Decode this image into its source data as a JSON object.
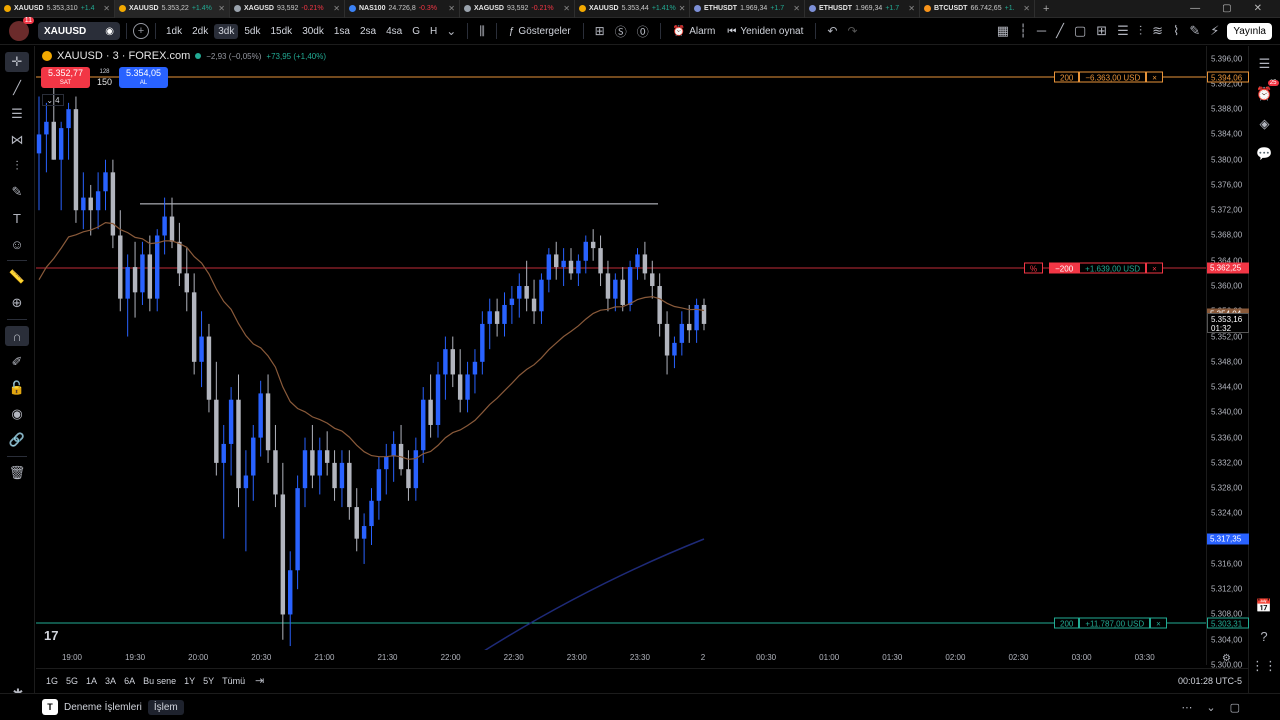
{
  "browser_tabs": [
    {
      "symbol": "XAUUSD",
      "price": "5.353,310",
      "change": "+1.4",
      "dir": "up",
      "active": false,
      "dot": ""
    },
    {
      "symbol": "XAUUSD",
      "price": "5.353,22",
      "change": "+1.4%",
      "dir": "up",
      "active": true,
      "dot": ""
    },
    {
      "symbol": "XAGUSD",
      "price": "93,592",
      "change": "-0.21%",
      "dir": "dn",
      "active": false,
      "dot": "xag"
    },
    {
      "symbol": "NAS100",
      "price": "24.726,8",
      "change": "-0.3%",
      "dir": "dn",
      "active": false,
      "dot": "nas"
    },
    {
      "symbol": "XAGUSD",
      "price": "93,592",
      "change": "-0.21%",
      "dir": "dn",
      "active": false,
      "dot": "xag"
    },
    {
      "symbol": "XAUUSD",
      "price": "5.353,44",
      "change": "+1.41%",
      "dir": "up",
      "active": false,
      "dot": ""
    },
    {
      "symbol": "ETHUSDT",
      "price": "1.969,34",
      "change": "+1.7",
      "dir": "up",
      "active": false,
      "dot": "eth"
    },
    {
      "symbol": "ETHUSDT",
      "price": "1.969,34",
      "change": "+1.7",
      "dir": "up",
      "active": false,
      "dot": "eth"
    },
    {
      "symbol": "BTCUSDT",
      "price": "66.742,65",
      "change": "+1.",
      "dir": "up",
      "active": false,
      "dot": "btc"
    }
  ],
  "toolbar": {
    "avatar_badge": "11",
    "symbol": "XAUUSD",
    "timeframes": [
      "1dk",
      "2dk",
      "3dk",
      "5dk",
      "15dk",
      "30dk",
      "1sa",
      "2sa",
      "4sa",
      "G",
      "H"
    ],
    "active_timeframe": "3dk",
    "indicators_label": "Göstergeler",
    "alarm_label": "Alarm",
    "replay_label": "Yeniden oynat",
    "publish_label": "Yayınla"
  },
  "legend": {
    "title": "XAUUSD · 3 · FOREX.com",
    "change": "−2,93 (−0,05%)",
    "change2": "+73,95 (+1,40%)",
    "sell_price": "5.352,77",
    "sell_label": "SAT",
    "buy_price": "5.354,05",
    "buy_label": "AL",
    "spread_top": "128",
    "spread_qty": "150",
    "collapse_count": "4"
  },
  "price_axis": {
    "ticks": [
      "5.396,00",
      "5.392,00",
      "5.388,00",
      "5.384,00",
      "5.380,00",
      "5.376,00",
      "5.372,00",
      "5.368,00",
      "5.364,00",
      "5.360,00",
      "5.356,00",
      "5.352,00",
      "5.348,00",
      "5.344,00",
      "5.340,00",
      "5.336,00",
      "5.332,00",
      "5.328,00",
      "5.324,00",
      "5.320,00",
      "5.316,00",
      "5.312,00",
      "5.308,00",
      "5.304,00",
      "5.300,00"
    ],
    "tag_tp": "5.394,06",
    "tag_pos": "5.362,25",
    "tag_last": "5.353,16",
    "tag_countdown": "01:32",
    "tag_blue": "5.317,35",
    "tag_sl": "5.303,31",
    "tag_ema": "5.354,04"
  },
  "orders": {
    "tp": {
      "qty": "200",
      "pnl": "−6.363,00 USD",
      "close": "×"
    },
    "pos": {
      "pct": "%",
      "qty": "−200",
      "pnl": "+1.639,00 USD",
      "close": "×"
    },
    "sl": {
      "qty": "200",
      "pnl": "+11.787,00 USD",
      "close": "×"
    }
  },
  "time_axis": [
    "19:00",
    "19:30",
    "20:00",
    "20:30",
    "21:00",
    "21:30",
    "22:00",
    "22:30",
    "23:00",
    "23:30",
    "2",
    "00:30",
    "01:00",
    "01:30",
    "02:00",
    "02:30",
    "03:00",
    "03:30"
  ],
  "range_bar": {
    "ranges": [
      "1G",
      "5G",
      "1A",
      "3A",
      "6A",
      "Bu sene",
      "1Y",
      "5Y",
      "Tümü"
    ],
    "clock": "00:01:28 UTC-5"
  },
  "bottom_panel": {
    "logo": "T",
    "items": [
      "Deneme İşlemleri",
      "İşlem"
    ]
  },
  "colors": {
    "up": "#2962ff",
    "down": "#b2b5be",
    "ema": "#8a5a3a",
    "tp_line": "#e8943a",
    "pos_line": "#f23645",
    "sl_line": "#22ab94",
    "blue_line": "#1e2a78"
  },
  "chart_data": {
    "type": "candlestick",
    "symbol": "XAUUSD",
    "interval": "3",
    "ylim": [
      5300,
      5398
    ],
    "x_labels": [
      "19:00",
      "19:30",
      "20:00",
      "20:30",
      "21:00",
      "21:30",
      "22:00",
      "22:30",
      "23:00",
      "23:30",
      "2"
    ],
    "candles": [
      [
        5381,
        5390,
        5372,
        5384
      ],
      [
        5384,
        5389,
        5378,
        5386
      ],
      [
        5386,
        5392,
        5380,
        5380
      ],
      [
        5380,
        5386,
        5372,
        5385
      ],
      [
        5385,
        5389,
        5380,
        5388
      ],
      [
        5388,
        5390,
        5370,
        5372
      ],
      [
        5372,
        5378,
        5369,
        5374
      ],
      [
        5374,
        5376,
        5368,
        5372
      ],
      [
        5372,
        5378,
        5369,
        5375
      ],
      [
        5375,
        5380,
        5372,
        5378
      ],
      [
        5378,
        5380,
        5366,
        5368
      ],
      [
        5368,
        5372,
        5356,
        5358
      ],
      [
        5358,
        5365,
        5352,
        5363
      ],
      [
        5363,
        5367,
        5355,
        5359
      ],
      [
        5359,
        5367,
        5357,
        5365
      ],
      [
        5365,
        5368,
        5356,
        5358
      ],
      [
        5358,
        5369,
        5356,
        5368
      ],
      [
        5368,
        5374,
        5365,
        5371
      ],
      [
        5371,
        5374,
        5366,
        5367
      ],
      [
        5367,
        5370,
        5360,
        5362
      ],
      [
        5362,
        5366,
        5356,
        5359
      ],
      [
        5359,
        5362,
        5346,
        5348
      ],
      [
        5348,
        5356,
        5344,
        5352
      ],
      [
        5352,
        5354,
        5340,
        5342
      ],
      [
        5342,
        5348,
        5330,
        5332
      ],
      [
        5332,
        5338,
        5320,
        5335
      ],
      [
        5335,
        5344,
        5330,
        5342
      ],
      [
        5342,
        5346,
        5325,
        5328
      ],
      [
        5328,
        5334,
        5318,
        5330
      ],
      [
        5330,
        5338,
        5326,
        5336
      ],
      [
        5336,
        5345,
        5333,
        5343
      ],
      [
        5343,
        5346,
        5332,
        5334
      ],
      [
        5334,
        5338,
        5325,
        5327
      ],
      [
        5327,
        5332,
        5304,
        5308
      ],
      [
        5308,
        5318,
        5303,
        5315
      ],
      [
        5315,
        5330,
        5312,
        5328
      ],
      [
        5328,
        5336,
        5325,
        5334
      ],
      [
        5334,
        5338,
        5328,
        5330
      ],
      [
        5330,
        5336,
        5327,
        5334
      ],
      [
        5334,
        5337,
        5330,
        5332
      ],
      [
        5332,
        5334,
        5326,
        5328
      ],
      [
        5328,
        5334,
        5325,
        5332
      ],
      [
        5332,
        5334,
        5323,
        5325
      ],
      [
        5325,
        5328,
        5318,
        5320
      ],
      [
        5320,
        5324,
        5316,
        5322
      ],
      [
        5322,
        5328,
        5319,
        5326
      ],
      [
        5326,
        5333,
        5323,
        5331
      ],
      [
        5331,
        5335,
        5327,
        5333
      ],
      [
        5333,
        5337,
        5329,
        5335
      ],
      [
        5335,
        5338,
        5330,
        5331
      ],
      [
        5331,
        5334,
        5326,
        5328
      ],
      [
        5328,
        5336,
        5326,
        5334
      ],
      [
        5334,
        5344,
        5332,
        5342
      ],
      [
        5342,
        5346,
        5336,
        5338
      ],
      [
        5338,
        5348,
        5336,
        5346
      ],
      [
        5346,
        5352,
        5342,
        5350
      ],
      [
        5350,
        5352,
        5344,
        5346
      ],
      [
        5346,
        5350,
        5340,
        5342
      ],
      [
        5342,
        5348,
        5340,
        5346
      ],
      [
        5346,
        5350,
        5343,
        5348
      ],
      [
        5348,
        5356,
        5346,
        5354
      ],
      [
        5354,
        5358,
        5350,
        5356
      ],
      [
        5356,
        5358,
        5352,
        5354
      ],
      [
        5354,
        5359,
        5352,
        5357
      ],
      [
        5357,
        5360,
        5354,
        5358
      ],
      [
        5358,
        5362,
        5355,
        5360
      ],
      [
        5360,
        5364,
        5356,
        5358
      ],
      [
        5358,
        5361,
        5354,
        5356
      ],
      [
        5356,
        5362,
        5354,
        5361
      ],
      [
        5361,
        5366,
        5359,
        5365
      ],
      [
        5365,
        5367,
        5361,
        5363
      ],
      [
        5363,
        5366,
        5360,
        5364
      ],
      [
        5364,
        5366,
        5361,
        5362
      ],
      [
        5362,
        5365,
        5360,
        5364
      ],
      [
        5364,
        5368,
        5362,
        5367
      ],
      [
        5367,
        5369,
        5364,
        5366
      ],
      [
        5366,
        5368,
        5360,
        5362
      ],
      [
        5362,
        5364,
        5356,
        5358
      ],
      [
        5358,
        5362,
        5356,
        5361
      ],
      [
        5361,
        5363,
        5356,
        5357
      ],
      [
        5357,
        5364,
        5356,
        5363
      ],
      [
        5363,
        5366,
        5361,
        5365
      ],
      [
        5365,
        5367,
        5361,
        5362
      ],
      [
        5362,
        5364,
        5358,
        5360
      ],
      [
        5360,
        5362,
        5352,
        5354
      ],
      [
        5354,
        5356,
        5346,
        5349
      ],
      [
        5349,
        5352,
        5347,
        5351
      ],
      [
        5351,
        5356,
        5349,
        5354
      ],
      [
        5354,
        5357,
        5351,
        5353
      ],
      [
        5353,
        5358,
        5351,
        5357
      ],
      [
        5357,
        5358,
        5353,
        5354
      ]
    ],
    "overlays": {
      "ema": "brown moving average line",
      "horizontal_line": 5373
    }
  }
}
